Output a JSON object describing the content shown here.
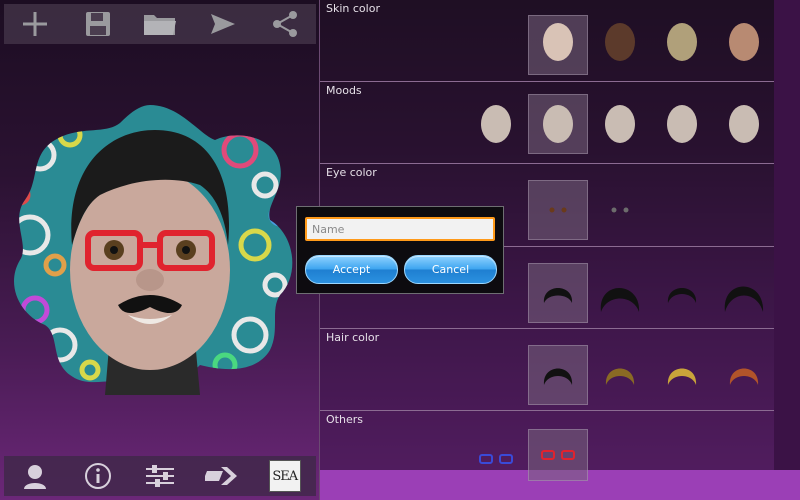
{
  "toolbar_top": {
    "new_icon": "plus-icon",
    "save_icon": "save-icon",
    "open_icon": "folder-open-icon",
    "send_icon": "send-icon",
    "share_icon": "share-icon"
  },
  "toolbar_bottom": {
    "profile_icon": "person-icon",
    "info_icon": "info-icon",
    "adjust_icon": "sliders-icon",
    "next_icon": "forward-arrow-icon",
    "logo_text": "SEA"
  },
  "categories": [
    {
      "label": "Skin color"
    },
    {
      "label": "Moods"
    },
    {
      "label": "Eye color"
    },
    {
      "label": ""
    },
    {
      "label": "Hair color"
    },
    {
      "label": "Others"
    }
  ],
  "dialog": {
    "name_placeholder": "Name",
    "name_value": "",
    "accept_label": "Accept",
    "cancel_label": "Cancel"
  },
  "colors": {
    "input_border": "#ff9a1a",
    "button_blue": "#2b91e0",
    "background_purple": "#8a2aa3"
  }
}
